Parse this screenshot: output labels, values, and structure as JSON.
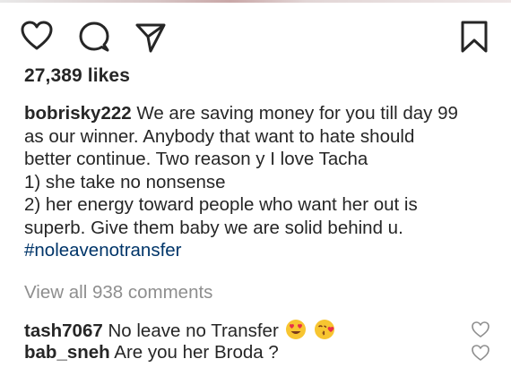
{
  "post": {
    "likes_text": "27,389 likes",
    "caption": {
      "username": "bobrisky222",
      "line1": "We are saving money for you till day 99",
      "line2": "as our winner. Anybody that want to hate should",
      "line3": "better continue. Two reason y I love Tacha",
      "line4": "1) she take no nonsense",
      "line5": "2) her energy toward people who want her out is",
      "line6": "superb. Give them baby we are solid behind u.",
      "hashtag": "#noleavenotransfer"
    },
    "view_all_comments": "View all 938 comments",
    "comments": [
      {
        "username": "tash7067",
        "text": "No leave no Transfer",
        "emojis": [
          "heart-eyes-emoji",
          "kissing-heart-emoji"
        ]
      },
      {
        "username": "bab_sneh",
        "text": "Are you her Broda ?"
      }
    ]
  },
  "icons": {
    "like": "heart-icon",
    "comment": "comment-bubble-icon",
    "share": "paper-plane-icon",
    "save": "bookmark-icon",
    "comment_like": "small-heart-icon"
  },
  "colors": {
    "text": "#262626",
    "muted": "#8e8e8e",
    "hashtag": "#003569",
    "emoji_face": "#f7c531",
    "emoji_heart": "#e8304a"
  }
}
